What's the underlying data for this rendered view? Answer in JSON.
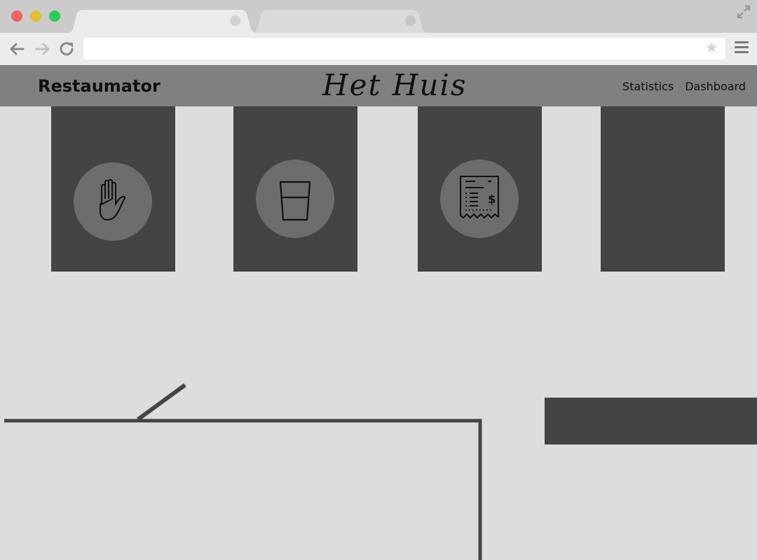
{
  "browser": {
    "url": "",
    "tabs": [
      {
        "label": "",
        "active": true
      },
      {
        "label": "",
        "active": false
      }
    ],
    "icons": [
      "back-arrow-icon",
      "forward-arrow-icon",
      "reload-icon",
      "star-icon",
      "menu-icon",
      "expand-icon"
    ]
  },
  "header": {
    "brand": "Restaumator",
    "restaurant_name": "Het Huis",
    "nav": {
      "statistics": "Statistics",
      "dashboard": "Dashboard"
    }
  },
  "actions": [
    {
      "name": "call-waiter",
      "icon": "hand-icon"
    },
    {
      "name": "order-drink",
      "icon": "glass-icon"
    },
    {
      "name": "request-bill",
      "icon": "receipt-icon"
    },
    {
      "name": "empty-slot",
      "icon": ""
    }
  ],
  "colors": {
    "page_background": "#dddddd",
    "header_background": "#808080",
    "card_background": "#444444",
    "icon_circle": "#6d6d6d"
  }
}
